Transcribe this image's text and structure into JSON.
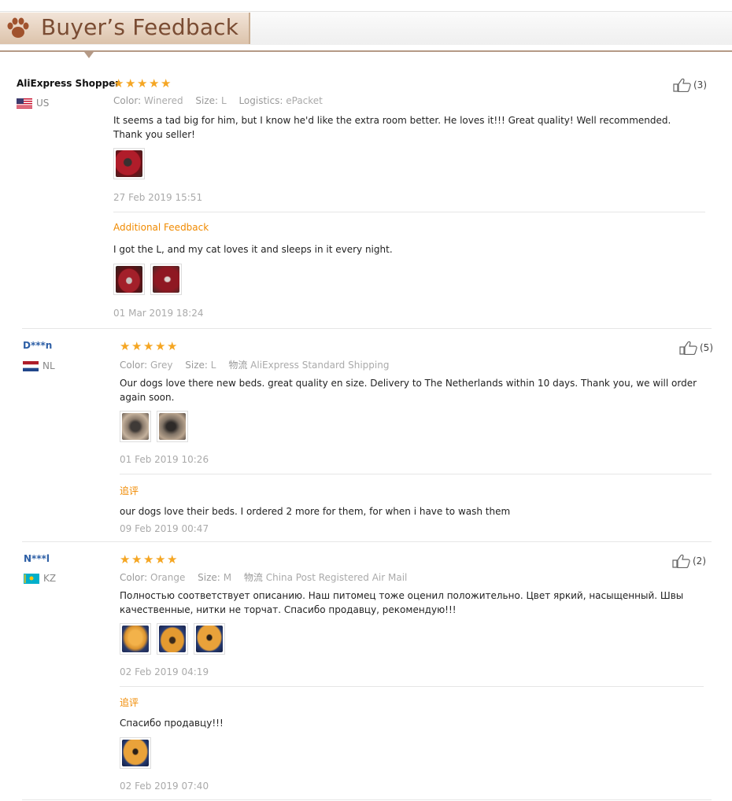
{
  "header": {
    "title": "Buyer’s Feedback"
  },
  "reviews": [
    {
      "buyer": "AliExpress Shopper",
      "country": "US",
      "rating": 5,
      "attrs": [
        {
          "key": "Color:",
          "value": "Winered"
        },
        {
          "key": "Size:",
          "value": "L"
        },
        {
          "key": "Logistics:",
          "value": "ePacket"
        }
      ],
      "text": "It seems a tad big for him, but I know he'd like the extra room better. He loves it!!! Great quality! Well recommended. Thank you seller!",
      "date": "27 Feb 2019 15:51",
      "likes": "(3)",
      "additional": {
        "label": "Additional Feedback",
        "text": "I got the L, and my cat loves it and sleeps in it every night.",
        "date": "01 Mar 2019 18:24"
      }
    },
    {
      "buyer": "D***n",
      "country": "NL",
      "rating": 5,
      "attrs": [
        {
          "key": "Color:",
          "value": "Grey"
        },
        {
          "key": "Size:",
          "value": "L"
        },
        {
          "key": "物流",
          "value": "AliExpress Standard Shipping"
        }
      ],
      "text": "Our dogs love there new beds. great quality en size. Delivery to The Netherlands within 10 days. Thank you, we will order again soon.",
      "date": "01 Feb 2019 10:26",
      "likes": "(5)",
      "additional": {
        "label": "追评",
        "text": "our dogs love their beds. I ordered 2 more for them, for when i have to wash them",
        "date": "09 Feb 2019 00:47"
      }
    },
    {
      "buyer": "N***l",
      "country": "KZ",
      "rating": 5,
      "attrs": [
        {
          "key": "Color:",
          "value": "Orange"
        },
        {
          "key": "Size:",
          "value": "M"
        },
        {
          "key": "物流",
          "value": "China Post Registered Air Mail"
        }
      ],
      "text": "Полностью соответствует описанию. Наш питомец тоже оценил положительно. Цвет яркий, насыщенный. Швы качественные, нитки не торчат. Спасибо продавцу, рекомендую!!!",
      "date": "02 Feb 2019 04:19",
      "likes": "(2)",
      "additional": {
        "label": "追评",
        "text": "Спасибо продавцу!!!",
        "date": "02 Feb 2019 07:40"
      }
    }
  ],
  "colors": {
    "accent": "#f08a00",
    "star": "#f5a623",
    "link": "#2d5fa6",
    "header_text": "#7a4c33"
  },
  "icons": {
    "paw": "paw-icon",
    "like": "thumbs-up-icon",
    "star": "star-icon"
  }
}
